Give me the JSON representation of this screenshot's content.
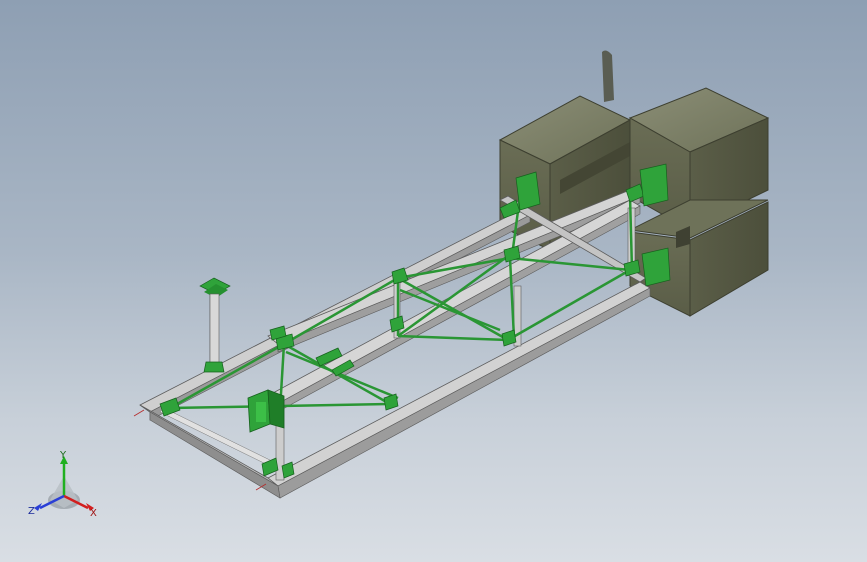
{
  "triad": {
    "x_label": "X",
    "y_label": "Y",
    "z_label": "Z"
  },
  "colors": {
    "background_top": "#8e9fb3",
    "background_bottom": "#d9dee4",
    "beam": "#c8c8c8",
    "beam_dark": "#8a8a8a",
    "connector_green": "#2fa33a",
    "counterweight": "#6b6e55",
    "axis_x": "#d21e1e",
    "axis_y": "#20b020",
    "axis_z": "#2a3fd6"
  }
}
